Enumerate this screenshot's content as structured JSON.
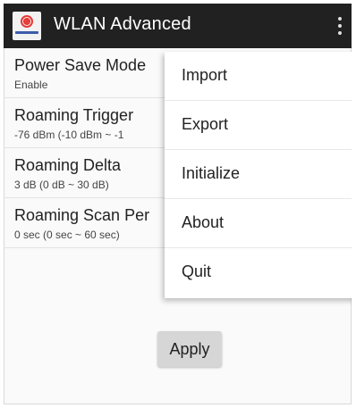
{
  "app_bar": {
    "title": "WLAN Advanced",
    "icon": "wlan-app-icon",
    "overflow_icon": "more-vert-icon"
  },
  "settings": [
    {
      "title": "Power Save Mode",
      "value": "Enable"
    },
    {
      "title": "Roaming Trigger",
      "value": "-76 dBm  (-10 dBm ~ -1"
    },
    {
      "title": "Roaming Delta",
      "value": "3 dB  (0 dB ~ 30 dB)"
    },
    {
      "title": "Roaming Scan Per",
      "value": "0 sec (0 sec ~ 60 sec)"
    }
  ],
  "apply_label": "Apply",
  "overflow_menu": [
    "Import",
    "Export",
    "Initialize",
    "About",
    "Quit"
  ]
}
